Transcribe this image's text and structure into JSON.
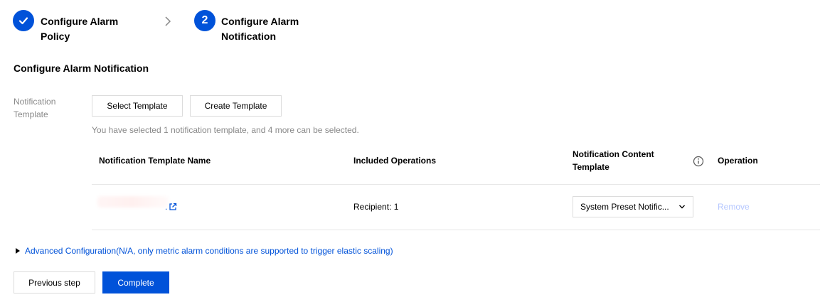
{
  "stepper": {
    "steps": [
      {
        "title_line1": "Configure Alarm",
        "title_line2": "Policy",
        "state": "done",
        "icon": "check-icon"
      },
      {
        "number": "2",
        "title_line1": "Configure Alarm",
        "title_line2": "Notification",
        "state": "active"
      }
    ],
    "separator_icon": "chevron-right-icon"
  },
  "section": {
    "title": "Configure Alarm Notification"
  },
  "notification": {
    "label_line1": "Notification",
    "label_line2": "Template",
    "select_template_label": "Select Template",
    "create_template_label": "Create Template",
    "hint": "You have selected 1 notification template, and 4 more can be selected."
  },
  "table": {
    "headers": {
      "name": "Notification Template Name",
      "operations": "Included Operations",
      "content_line1": "Notification Content",
      "content_line2": "Template",
      "operation": "Operation"
    },
    "rows": [
      {
        "name_suffix": ".",
        "operations": "Recipient: 1",
        "content_template": "System Preset Notific...",
        "remove_label": "Remove"
      }
    ]
  },
  "advanced": {
    "label": "Advanced Configuration(N/A, only metric alarm conditions are supported to trigger elastic scaling)"
  },
  "footer": {
    "previous_label": "Previous step",
    "complete_label": "Complete"
  },
  "colors": {
    "primary": "#0052d9",
    "muted": "#888888",
    "disabled_link": "#b5c7ff",
    "border": "#dcdcdc"
  }
}
